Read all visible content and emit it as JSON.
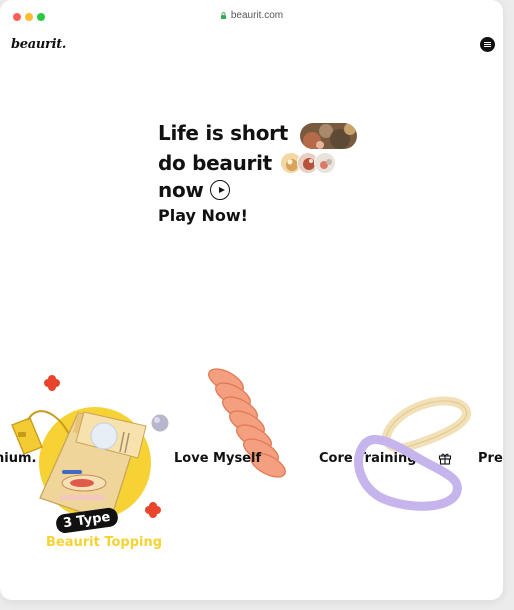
{
  "browser": {
    "url": "beaurit.com"
  },
  "header": {
    "logo": "beaurit."
  },
  "hero": {
    "line1": "Life is short",
    "line2": "do beaurit",
    "line3": "now",
    "cta": "Play Now!"
  },
  "marquee": {
    "items": [
      "nium.",
      "Love Myself",
      "Core Training",
      "Prem"
    ]
  },
  "product": {
    "badge": "3 Type",
    "label": "Beaurit Topping"
  },
  "colors": {
    "accent_yellow": "#f6d235",
    "coral": "#f08c6a",
    "lavender": "#c6b4ec",
    "cream": "#f4e6c5",
    "red_flower": "#e8452c"
  }
}
